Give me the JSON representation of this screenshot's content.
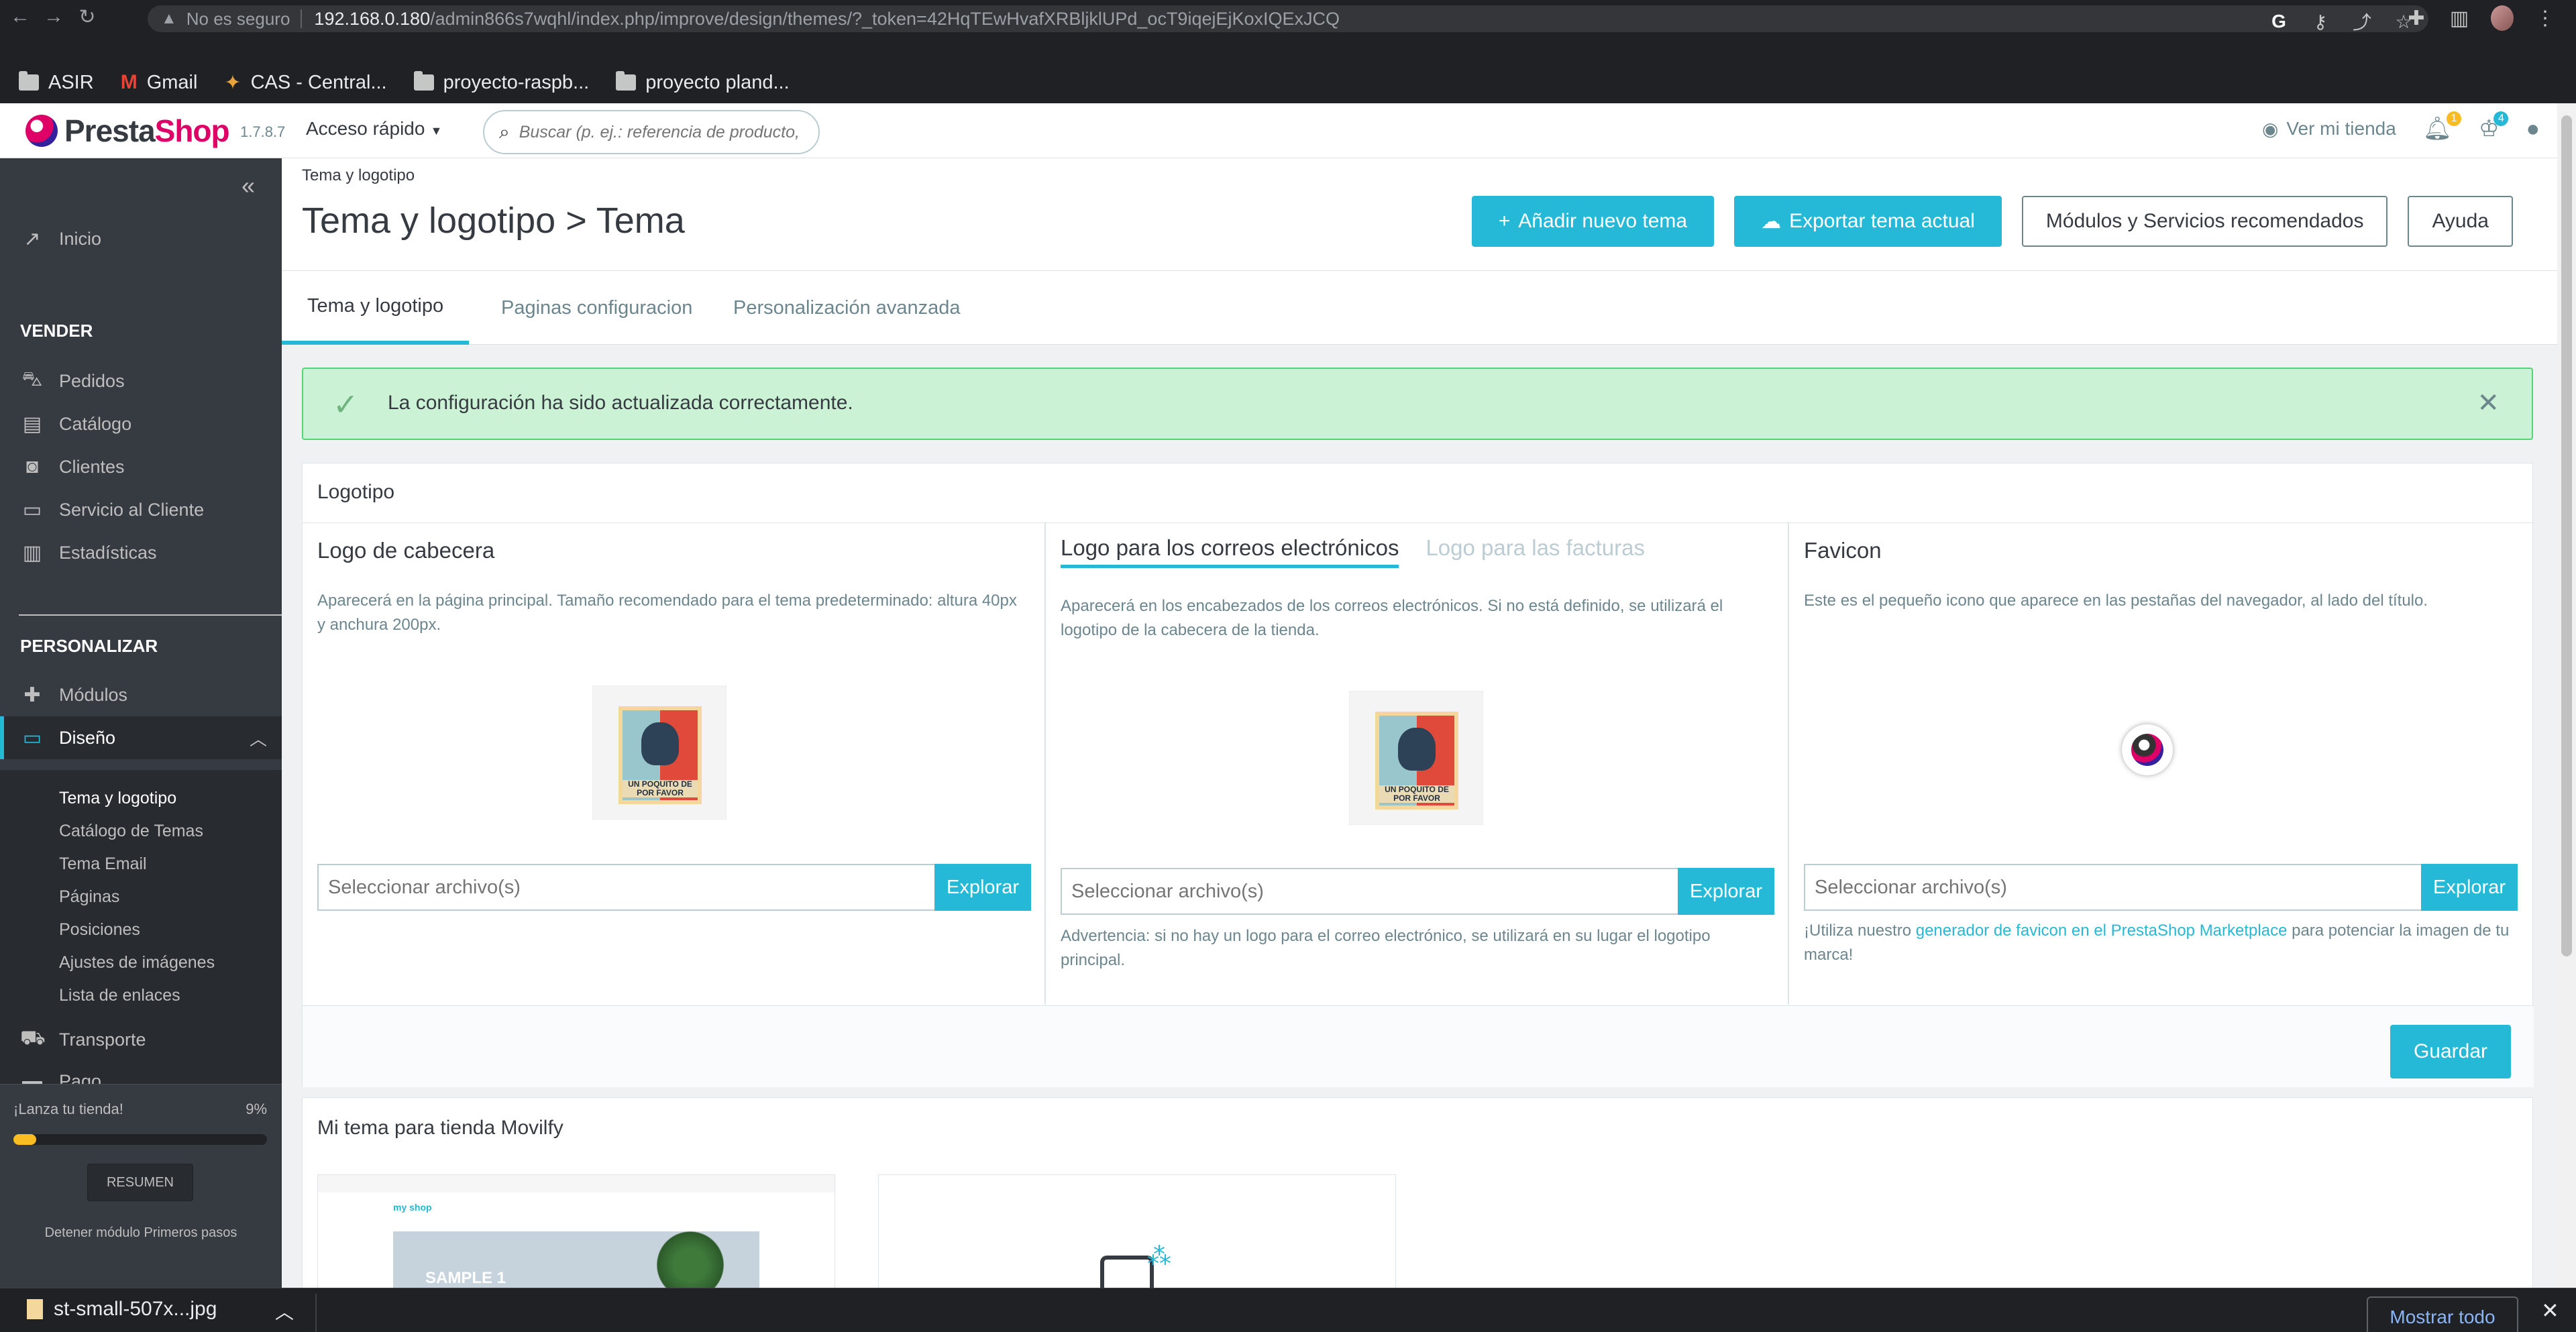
{
  "browser": {
    "insecure_label": "No es seguro",
    "url_host": "192.168.0.180",
    "url_path": "/admin866s7wqhl/index.php/improve/design/themes/?_token=42HqTEwHvafXRBljklUPd_ocT9iqejEjKoxIQExJCQ",
    "bookmarks": [
      "ASIR",
      "Gmail",
      "CAS - Central...",
      "proyecto-raspb...",
      "proyecto pland..."
    ]
  },
  "header": {
    "logo_presta": "Presta",
    "logo_shop": "Shop",
    "version": "1.7.8.7",
    "quick_access": "Acceso rápido",
    "search_placeholder": "Buscar (p. ej.: referencia de producto,",
    "view_store": "Ver mi tienda",
    "notif_orders_count": "1",
    "notif_customers_count": "4"
  },
  "sidebar": {
    "home": "Inicio",
    "section_sell": "VENDER",
    "sell_items": [
      "Pedidos",
      "Catálogo",
      "Clientes",
      "Servicio al Cliente",
      "Estadísticas"
    ],
    "section_customize": "PERSONALIZAR",
    "modules": "Módulos",
    "design": "Diseño",
    "design_sub": [
      "Tema y logotipo",
      "Catálogo de Temas",
      "Tema Email",
      "Páginas",
      "Posiciones",
      "Ajustes de imágenes",
      "Lista de enlaces"
    ],
    "shipping": "Transporte",
    "payment": "Pago",
    "onboarding_title": "¡Lanza tu tienda!",
    "onboarding_pct": "9%",
    "onboarding_progress": 0.09,
    "onboarding_button": "RESUMEN",
    "onboarding_stop": "Detener módulo Primeros pasos"
  },
  "page": {
    "breadcrumb": "Tema y logotipo",
    "title": "Tema y logotipo > Tema",
    "btn_add_theme": "Añadir nuevo tema",
    "btn_export_theme": "Exportar tema actual",
    "btn_recommended": "Módulos y Servicios recomendados",
    "btn_help": "Ayuda",
    "tabs": [
      "Tema y logotipo",
      "Paginas configuracion",
      "Personalización avanzada"
    ],
    "alert_message": "La configuración ha sido actualizada correctamente."
  },
  "logo_card": {
    "title": "Logotipo",
    "header_logo": {
      "title": "Logo de cabecera",
      "help": "Aparecerá en la página principal. Tamaño recomendado para el tema predeterminado: altura 40px y anchura 200px.",
      "poster_text": "UN POQUITO DE POR FAVOR"
    },
    "email_logo": {
      "tab_active": "Logo para los correos electrónicos",
      "tab_inactive": "Logo para las facturas",
      "help": "Aparecerá en los encabezados de los correos electrónicos. Si no está definido, se utilizará el logotipo de la cabecera de la tienda.",
      "warning": "Advertencia: si no hay un logo para el correo electrónico, se utilizará en su lugar el logotipo principal.",
      "poster_text": "UN POQUITO DE POR FAVOR"
    },
    "favicon": {
      "title": "Favicon",
      "help": "Este es el pequeño icono que aparece en las pestañas del navegador, al lado del título.",
      "footer_pre": "¡Utiliza nuestro ",
      "footer_link": "generador de favicon en el PrestaShop Marketplace",
      "footer_post": " para potenciar la imagen de tu marca!"
    },
    "file_placeholder": "Seleccionar archivo(s)",
    "browse_label": "Explorar",
    "save_label": "Guardar"
  },
  "theme_card": {
    "title": "Mi tema para tienda Movilfy",
    "thumb_sample": "SAMPLE 1",
    "thumb_logo": "my shop"
  },
  "downloads": {
    "file_name": "st-small-507x...jpg",
    "show_all": "Mostrar todo"
  }
}
